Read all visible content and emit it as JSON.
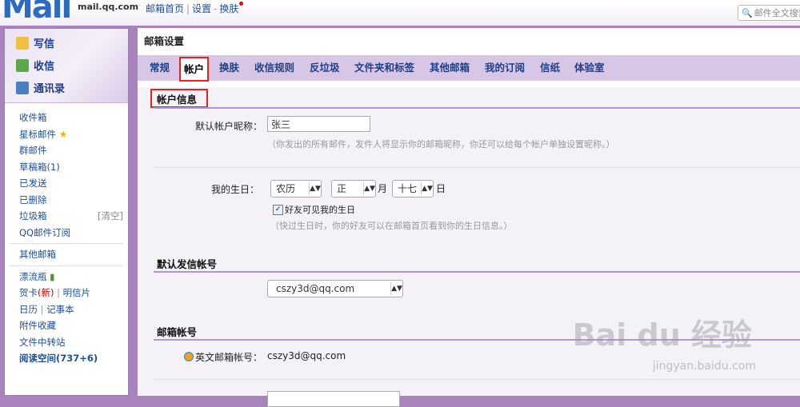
{
  "header": {
    "logo_text": "Mail",
    "domain": "mail.qq.com",
    "links": [
      "邮箱首页",
      "设置",
      "换肤"
    ],
    "search_placeholder": "邮件全文搜索"
  },
  "sidebar": {
    "actions": [
      "写信",
      "收信",
      "通讯录"
    ],
    "folders": [
      {
        "label": "收件箱"
      },
      {
        "label": "星标邮件"
      },
      {
        "label": "群邮件"
      },
      {
        "label": "草稿箱(1)"
      },
      {
        "label": "已发送"
      },
      {
        "label": "已删除"
      },
      {
        "label": "垃圾箱",
        "aside": "[清空]"
      },
      {
        "label": "QQ邮件订阅"
      }
    ],
    "other": "其他邮箱",
    "extras": {
      "bottle": "漂流瓶",
      "card": "贺卡",
      "card_new": "(新)",
      "postcard": "明信片",
      "calendar": "日历",
      "notes": "记事本",
      "attachments": "附件收藏",
      "transfer": "文件中转站",
      "reading": "阅读空间(737+6)"
    }
  },
  "main": {
    "title": "邮箱设置",
    "tabs": [
      "常规",
      "帐户",
      "换肤",
      "收信规则",
      "反垃圾",
      "文件夹和标签",
      "其他邮箱",
      "我的订阅",
      "信纸",
      "体验室"
    ],
    "active_tab": "帐户"
  },
  "account_info": {
    "title": "帐户信息",
    "nickname_label": "默认帐户昵称：",
    "nickname_value": "张三",
    "nickname_hint": "（你发出的所有邮件，发件人将显示你的邮箱昵称，你还可以给每个帐户单独设置昵称。）",
    "birthday_label": "我的生日：",
    "calendar_type": "农历",
    "month": "正",
    "month_unit": "月",
    "day": "十七",
    "day_unit": "日",
    "friends_visible_label": "好友可见我的生日",
    "birthday_hint": "（快过生日时，你的好友可以在邮箱首页看到你的生日信息。）"
  },
  "default_sender": {
    "title": "默认发信帐号",
    "value": "cszy3d@qq.com"
  },
  "mailbox_accounts": {
    "title": "邮箱帐号",
    "english_label": "英文邮箱帐号：",
    "english_value": "cszy3d@qq.com"
  },
  "watermark": {
    "main": "Bai du 经验",
    "sub": "jingyan.baidu.com"
  },
  "colors": {
    "accent": "#a883bd",
    "tab_bar": "#d8c6e6",
    "highlight": "#e82020",
    "link": "#1e4f9c"
  }
}
